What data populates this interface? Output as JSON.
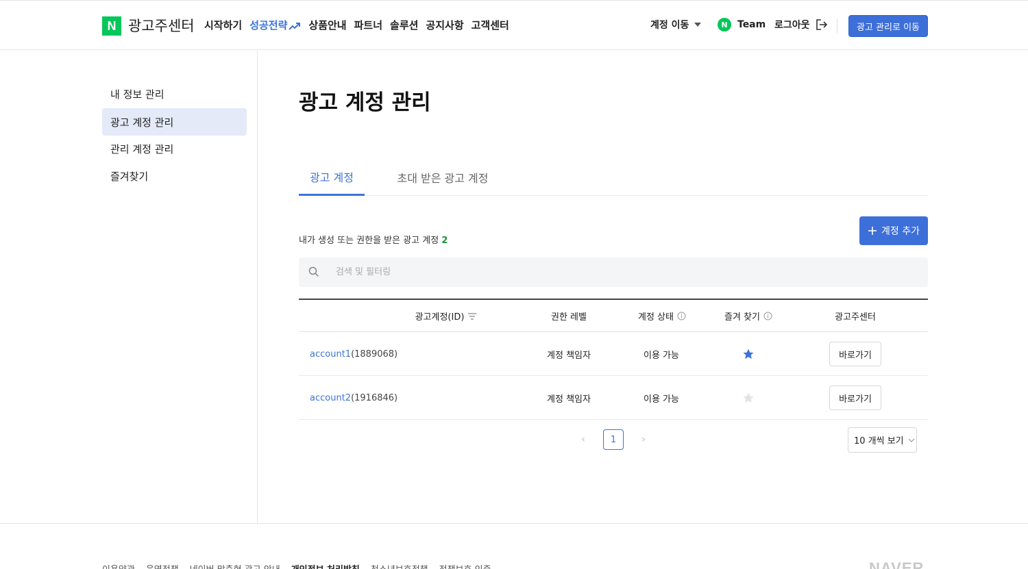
{
  "header": {
    "logo_letter": "N",
    "logo_text": "광고주센터",
    "nav": [
      {
        "label": "시작하기"
      },
      {
        "label": "성공전략"
      },
      {
        "label": "상품안내"
      },
      {
        "label": "파트너"
      },
      {
        "label": "솔루션"
      },
      {
        "label": "공지사항"
      },
      {
        "label": "고객센터"
      }
    ],
    "account_move": "계정 이동",
    "team_badge": "N",
    "team_label": "Team",
    "logout_label": "로그아웃",
    "go_ad_manage": "광고 관리로 이동"
  },
  "sidebar": {
    "items": [
      {
        "label": "내 정보 관리"
      },
      {
        "label": "광고 계정 관리"
      },
      {
        "label": "관리 계정 관리"
      },
      {
        "label": "즐겨찾기"
      }
    ]
  },
  "main": {
    "title": "광고 계정 관리",
    "tabs": [
      {
        "label": "광고 계정"
      },
      {
        "label": "초대 받은 광고 계정"
      }
    ],
    "count_label": "내가 생성 또는 권한을 받은 광고 계정",
    "count_value": "2",
    "add_button": "계정 추가",
    "search_placeholder": "검색 및 필터링",
    "table": {
      "headers": {
        "account": "광고계정(ID)",
        "permission": "권한 레벨",
        "status": "계정 상태",
        "favorite": "즐겨 찾기",
        "center": "광고주센터"
      },
      "rows": [
        {
          "name": "account1",
          "id": "(1889068)",
          "permission": "계정 책임자",
          "status": "이용 가능",
          "favorite": true,
          "button": "바로가기"
        },
        {
          "name": "account2",
          "id": "(1916846)",
          "permission": "계정 책임자",
          "status": "이용 가능",
          "favorite": false,
          "button": "바로가기"
        }
      ]
    },
    "pagination": {
      "current": "1",
      "per_page": "10 개씩 보기"
    }
  },
  "footer": {
    "links": [
      {
        "label": "이용약관",
        "bold": false
      },
      {
        "label": "운영정책",
        "bold": false
      },
      {
        "label": "네이버 맞춤형 광고 안내",
        "bold": false
      },
      {
        "label": "개인정보 처리방침",
        "bold": true
      },
      {
        "label": "청소년보호정책",
        "bold": false
      },
      {
        "label": "정책보호 인증",
        "bold": false
      }
    ],
    "brand": "NAVER"
  },
  "colors": {
    "accent": "#3d6fd9",
    "brand_green": "#03c75a",
    "active_bg": "#e4eaf8",
    "count_green": "#1a8f3c"
  }
}
